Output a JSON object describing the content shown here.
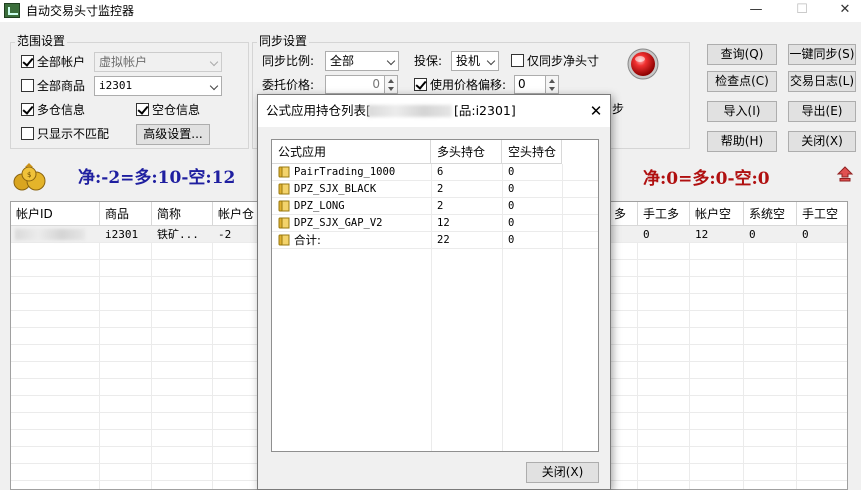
{
  "window": {
    "title": "自动交易头寸监控器",
    "min_glyph": "—",
    "max_glyph": "☐",
    "close_glyph": "✕"
  },
  "scope": {
    "group_label": "范围设置",
    "all_accounts_label": "全部帐户",
    "all_accounts_checked": true,
    "account_value": "虚拟帐户",
    "all_products_label": "全部商品",
    "all_products_checked": false,
    "product_value": "i2301",
    "long_info_label": "多仓信息",
    "long_info_checked": true,
    "short_info_label": "空仓信息",
    "short_info_checked": true,
    "only_mismatch_label": "只显示不匹配",
    "only_mismatch_checked": false,
    "advanced_button": "高级设置..."
  },
  "sync": {
    "group_label": "同步设置",
    "ratio_label": "同步比例:",
    "ratio_value": "全部",
    "hedge_label": "投保:",
    "hedge_value": "投机",
    "net_only_label": "仅同步净头寸",
    "net_only_checked": false,
    "order_price_label": "委托价格:",
    "order_price_value": "0",
    "use_offset_label": "使用价格偏移:",
    "use_offset_checked": true,
    "offset_value": "0",
    "partial_text": "步"
  },
  "status_light": {
    "color": "#e02020"
  },
  "buttons": {
    "query": "查询(Q)",
    "one_key_sync": "一键同步(S)",
    "checkpoint": "检查点(C)",
    "trade_log": "交易日志(L)",
    "import": "导入(I)",
    "export": "导出(E)",
    "help": "帮助(H)",
    "close": "关闭(X)"
  },
  "summary": {
    "left_text": "净:-2=多:10-空:12",
    "left_color": "#1f1fa0",
    "right_text": "净:0=多:0-空:0",
    "right_color": "#b01010"
  },
  "table": {
    "headers": [
      "帐户ID",
      "商品",
      "简称",
      "帐户仓",
      "",
      "",
      "",
      "",
      "",
      "",
      "",
      "系统多",
      "手工多",
      "帐户空",
      "系统空",
      "手工空"
    ],
    "visible_headers_left": [
      "帐户ID",
      "商品",
      "简称",
      "帐户仓"
    ],
    "visible_headers_right": [
      "多",
      "手工多",
      "帐户空",
      "系统空",
      "手工空"
    ],
    "row": {
      "product": "i2301",
      "short_name": "铁矿...",
      "account_pos": "-2",
      "manual_long": "0",
      "account_short": "12",
      "system_short": "0",
      "manual_short": "0"
    }
  },
  "modal": {
    "title_left": "公式应用持仓列表[",
    "title_right": "[品:i2301]",
    "headers": [
      "公式应用",
      "多头持仓",
      "空头持仓"
    ],
    "rows": [
      {
        "name": "PairTrading_1000",
        "long": "6",
        "short": "0"
      },
      {
        "name": "DPZ_SJX_BLACK",
        "long": "2",
        "short": "0"
      },
      {
        "name": "DPZ_LONG",
        "long": "2",
        "short": "0"
      },
      {
        "name": "DPZ_SJX_GAP_V2",
        "long": "12",
        "short": "0"
      },
      {
        "name": "合计:",
        "long": "22",
        "short": "0"
      }
    ],
    "close_button": "关闭(X)",
    "close_glyph": "✕"
  }
}
